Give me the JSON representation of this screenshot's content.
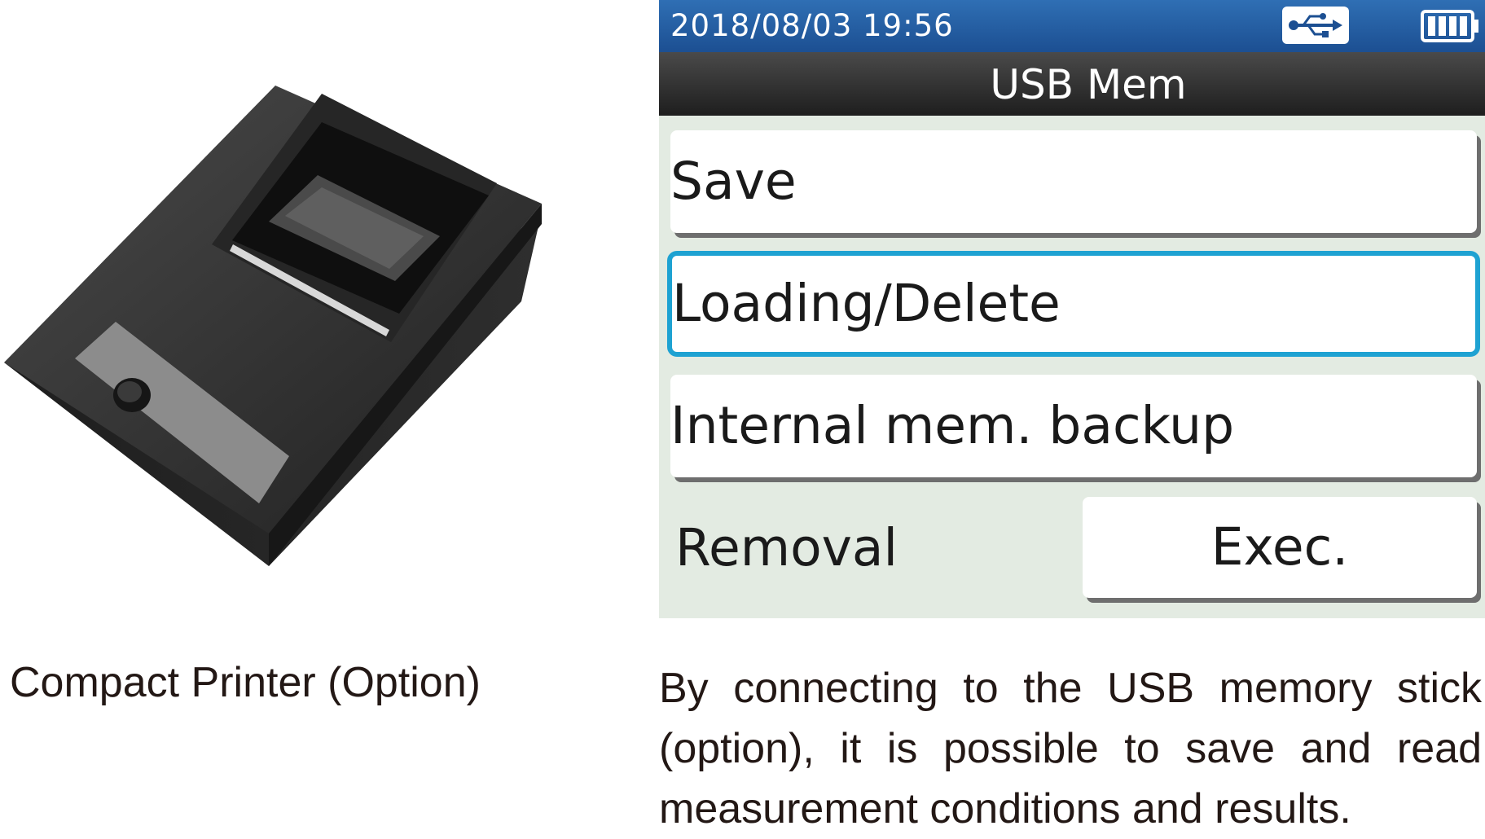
{
  "left_panel": {
    "caption": "Compact Printer (Option)",
    "image_subject": "compact-printer"
  },
  "device": {
    "status_bar": {
      "datetime": "2018/08/03 19:56",
      "usb_icon": "usb-icon",
      "battery_icon": "battery-full-icon"
    },
    "title": "USB Mem",
    "menu": {
      "save_label": "Save",
      "loading_delete_label": "Loading/Delete",
      "backup_label": "Internal mem. backup",
      "removal_label": "Removal",
      "exec_label": "Exec."
    },
    "colors": {
      "status_bar": "#1c4f92",
      "title_bar": "#2a2a2a",
      "background": "#e3ebe2",
      "selection": "#1ea2d2"
    }
  },
  "right_panel": {
    "description": "By connecting to the USB memory stick (option), it is possible to save and read measurement conditions and results."
  }
}
